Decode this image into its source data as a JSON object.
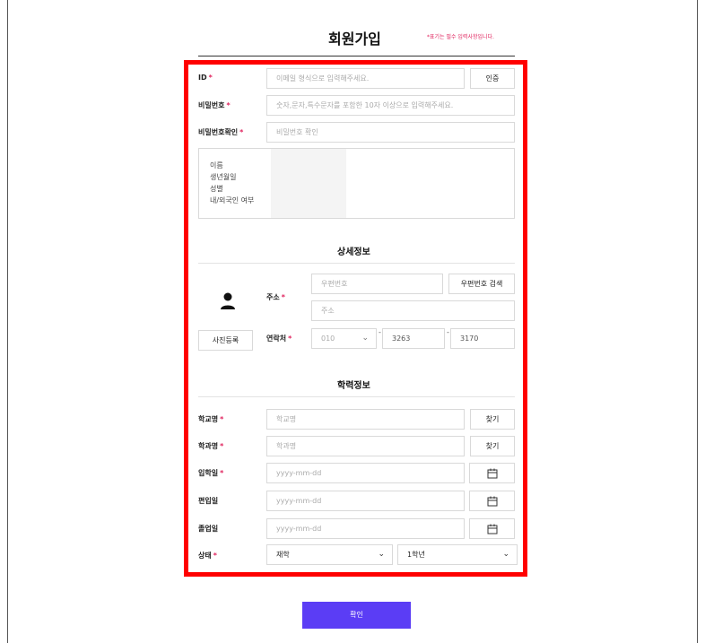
{
  "header": {
    "title": "회원가입",
    "required_note": "*표기는 필수 입력사항입니다."
  },
  "account": {
    "id_label": "ID",
    "id_placeholder": "이메일 형식으로 입력해주세요.",
    "verify_button": "인증",
    "password_label": "비밀번호",
    "password_placeholder": "숫자,문자,특수문자를 포함한 10자 이상으로 입력해주세요.",
    "password_confirm_label": "비밀번호확인",
    "password_confirm_placeholder": "비밀번호 확인",
    "required_mark": "*"
  },
  "info_box": {
    "items": [
      "이름",
      "생년월일",
      "성별",
      "내/외국인 여부"
    ]
  },
  "detail": {
    "section_title": "상세정보",
    "photo_button": "사진등록",
    "address_label": "주소",
    "postal_placeholder": "우편번호",
    "postal_search_button": "우편번호 검색",
    "address_placeholder": "주소",
    "phone_label": "연락처",
    "phone_prefix": "010",
    "phone_middle": "3263",
    "phone_last": "3170"
  },
  "education": {
    "section_title": "학력정보",
    "school_label": "학교명",
    "school_placeholder": "학교명",
    "school_find": "찾기",
    "major_label": "학과명",
    "major_placeholder": "학과명",
    "major_find": "찾기",
    "admission_label": "입학일",
    "admission_placeholder": "yyyy-mm-dd",
    "transfer_label": "편입일",
    "transfer_placeholder": "yyyy-mm-dd",
    "graduation_label": "졸업일",
    "graduation_placeholder": "yyyy-mm-dd",
    "status_label": "상태",
    "status_value": "재학",
    "grade_value": "1학년"
  },
  "footer": {
    "confirm_button": "확인"
  },
  "colors": {
    "accent": "#5b3df5",
    "required": "#e0245e",
    "highlight_border": "#ff0000"
  }
}
